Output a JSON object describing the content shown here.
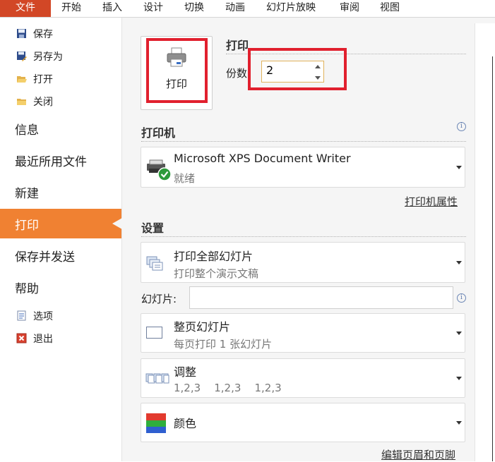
{
  "ribbon": {
    "tabs": [
      {
        "label": "文件",
        "active": true
      },
      {
        "label": "开始"
      },
      {
        "label": "插入"
      },
      {
        "label": "设计"
      },
      {
        "label": "切换"
      },
      {
        "label": "动画"
      },
      {
        "label": "幻灯片放映"
      },
      {
        "label": "审阅"
      },
      {
        "label": "视图"
      }
    ],
    "active_color": "#d24726"
  },
  "nav": {
    "small_top": [
      {
        "label": "保存",
        "icon": "save-icon"
      },
      {
        "label": "另存为",
        "icon": "save-as-icon"
      },
      {
        "label": "打开",
        "icon": "open-folder-icon"
      },
      {
        "label": "关闭",
        "icon": "close-folder-icon"
      }
    ],
    "big": [
      {
        "label": "信息"
      },
      {
        "label": "最近所用文件"
      },
      {
        "label": "新建"
      },
      {
        "label": "打印",
        "active": true
      },
      {
        "label": "保存并发送"
      },
      {
        "label": "帮助"
      }
    ],
    "small_bottom": [
      {
        "label": "选项",
        "icon": "options-icon"
      },
      {
        "label": "退出",
        "icon": "exit-icon"
      }
    ],
    "active_color": "#f08132"
  },
  "print": {
    "section_title": "打印",
    "button_label": "打印",
    "copies_label": "份数",
    "copies_value": "2"
  },
  "printer": {
    "section_title": "打印机",
    "name": "Microsoft XPS Document Writer",
    "status": "就绪",
    "properties_link": "打印机属性"
  },
  "settings": {
    "section_title": "设置",
    "range": {
      "main": "打印全部幻灯片",
      "sub": "打印整个演示文稿"
    },
    "slides_label": "幻灯片:",
    "slides_value": "",
    "layout": {
      "main": "整页幻灯片",
      "sub": "每页打印 1 张幻灯片"
    },
    "collate": {
      "main": "调整",
      "sub": "1,2,3    1,2,3    1,2,3"
    },
    "color": {
      "main": "颜色"
    },
    "header_footer_link": "编辑页眉和页脚"
  },
  "highlight_color": "#e1202e"
}
